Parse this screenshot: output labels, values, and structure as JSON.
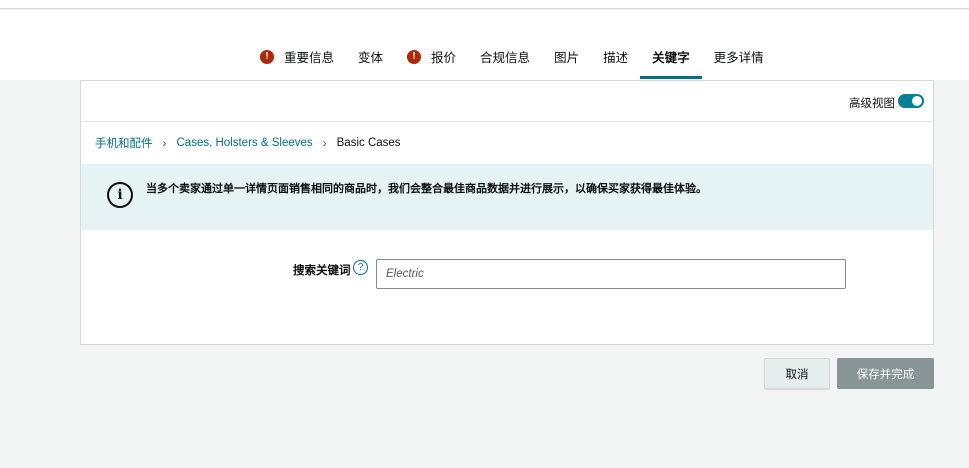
{
  "tabs": [
    {
      "label": "重要信息",
      "error": true
    },
    {
      "label": "变体",
      "error": false
    },
    {
      "label": "报价",
      "error": true
    },
    {
      "label": "合规信息",
      "error": false
    },
    {
      "label": "图片",
      "error": false
    },
    {
      "label": "描述",
      "error": false
    },
    {
      "label": "关键字",
      "error": false,
      "active": true
    },
    {
      "label": "更多详情",
      "error": false
    }
  ],
  "error_icon_glyph": "!",
  "advanced_view": {
    "label": "高级视图",
    "enabled": true
  },
  "breadcrumb": {
    "items": [
      "手机和配件",
      "Cases, Holsters & Sleeves"
    ],
    "current": "Basic Cases",
    "separator": "›"
  },
  "alert": {
    "icon": "info-icon",
    "text": "当多个卖家通过单一详情页面销售相同的商品时，我们会整合最佳商品数据并进行展示，以确保买家获得最佳体验。"
  },
  "keyword_field": {
    "label": "搜索关键词",
    "help_glyph": "?",
    "value": "Electric"
  },
  "buttons": {
    "cancel": "取消",
    "save": "保存并完成"
  },
  "colors": {
    "accent": "#007185",
    "error": "#b12704",
    "toggle": "#008296",
    "alert_bg": "#e6f3f5",
    "save_bg": "#879596"
  }
}
